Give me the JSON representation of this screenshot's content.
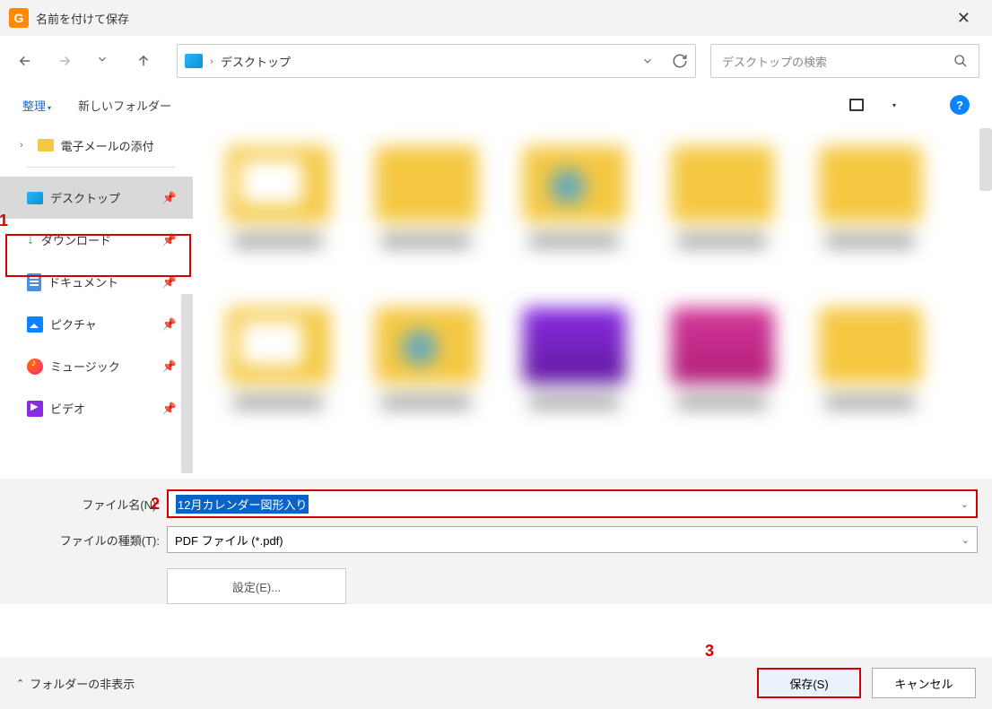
{
  "window": {
    "title": "名前を付けて保存"
  },
  "breadcrumb": {
    "location": "デスクトップ"
  },
  "search": {
    "placeholder": "デスクトップの検索"
  },
  "toolbar": {
    "organize": "整理",
    "newfolder": "新しいフォルダー"
  },
  "tree": {
    "mail": "電子メールの添付",
    "desktop": "デスクトップ",
    "downloads": "ダウンロード",
    "documents": "ドキュメント",
    "pictures": "ピクチャ",
    "music": "ミュージック",
    "video": "ビデオ"
  },
  "form": {
    "name_label": "ファイル名(N):",
    "name_value": "12月カレンダー図形入り",
    "type_label": "ファイルの種類(T):",
    "type_value": "PDF ファイル (*.pdf)",
    "settings": "設定(E)..."
  },
  "footer": {
    "hide": "フォルダーの非表示",
    "save": "保存(S)",
    "cancel": "キャンセル"
  },
  "annotations": {
    "n1": "1",
    "n2": "2",
    "n3": "3"
  }
}
